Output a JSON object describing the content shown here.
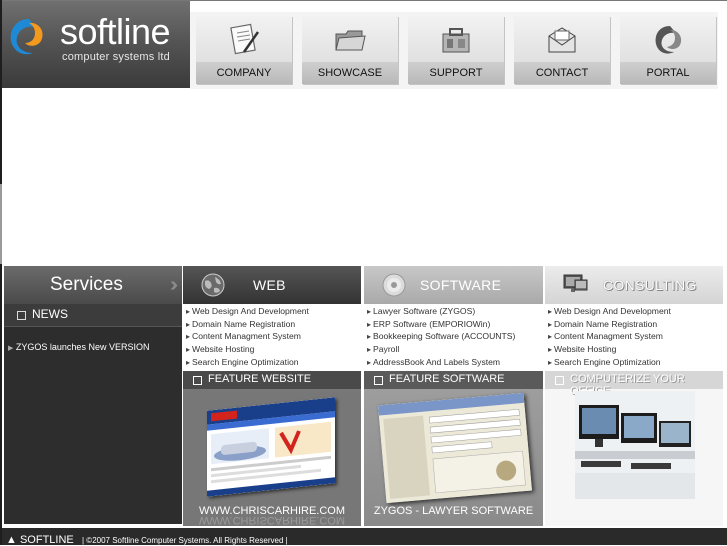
{
  "brand": {
    "name": "softline",
    "tagline": "computer systems ltd"
  },
  "nav": [
    {
      "label": "COMPANY",
      "icon": "document-pen-icon"
    },
    {
      "label": "SHOWCASE",
      "icon": "folder-icon"
    },
    {
      "label": "SUPPORT",
      "icon": "toolbox-icon"
    },
    {
      "label": "CONTACT",
      "icon": "envelope-icon"
    },
    {
      "label": "PORTAL",
      "icon": "swirl-icon"
    }
  ],
  "services": {
    "title": "Services",
    "news_title": "NEWS",
    "news_items": [
      "ZYGOS launches New VERSION"
    ]
  },
  "columns": {
    "web": {
      "title": "WEB",
      "icon": "globe-icon",
      "links": [
        "Web Design And Development",
        "Domain Name Registration",
        "Content Managment System",
        "Website Hosting",
        "Search Engine Optimization"
      ]
    },
    "software": {
      "title": "SOFTWARE",
      "icon": "cd-icon",
      "links": [
        "Lawyer Software (ZYGOS)",
        "ERP Software (EMPORIOWin)",
        "Bookkeeping Software (ACCOUNTS)",
        "Payroll",
        "AddressBook And Labels System"
      ]
    },
    "consulting": {
      "title": "CONSULTING",
      "icon": "monitor-icon",
      "links": [
        "Web Design And Development",
        "Domain Name Registration",
        "Content Managment System",
        "Website Hosting",
        "Search Engine Optimization"
      ]
    }
  },
  "features": {
    "web": {
      "title": "FEATURE WEBSITE",
      "caption": "WWW.CHRISCARHIRE.COM"
    },
    "software": {
      "title": "FEATURE SOFTWARE",
      "caption": "ZYGOS - LAWYER SOFTWARE"
    },
    "consulting": {
      "title": "COMPUTERIZE YOUR OFFICE",
      "caption": ""
    }
  },
  "footer": {
    "brand": "SOFTLINE",
    "copyright": "| ©2007 Softline Computer Systems. All Rights Reserved |"
  },
  "colors": {
    "accent_orange": "#f39a1e",
    "accent_blue": "#1e8ad6",
    "dark": "#2d2d2d"
  }
}
